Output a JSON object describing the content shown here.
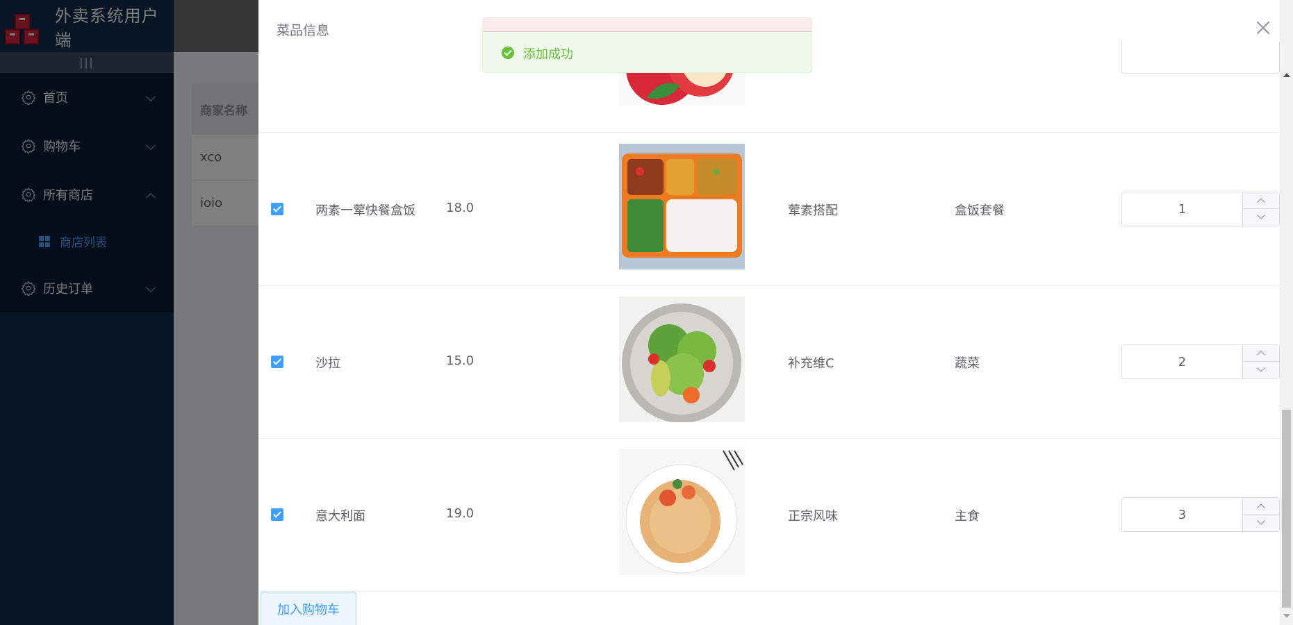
{
  "app": {
    "title": "外卖系统用户端",
    "collapse_glyph": "|||"
  },
  "sidebar": {
    "items": [
      {
        "label": "首页",
        "icon": "gear-icon",
        "expanded": false
      },
      {
        "label": "购物车",
        "icon": "gear-icon",
        "expanded": false
      },
      {
        "label": "所有商店",
        "icon": "gear-icon",
        "expanded": true
      },
      {
        "label": "历史订单",
        "icon": "gear-icon",
        "expanded": false
      }
    ],
    "sub_items": [
      {
        "label": "商店列表",
        "icon": "grid-icon",
        "active": true
      }
    ]
  },
  "background_table": {
    "header": "商家名称",
    "rows": [
      "xco",
      "ioio"
    ]
  },
  "drawer": {
    "title": "菜品信息",
    "rows": [
      {
        "name": "两素一荤快餐盒饭",
        "price": "18.0",
        "image": "bento-box-meal",
        "description": "荤素搭配",
        "category": "盒饭套餐",
        "quantity": "1",
        "checked": true
      },
      {
        "name": "沙拉",
        "price": "15.0",
        "image": "salad-plate",
        "description": "补充维C",
        "category": "蔬菜",
        "quantity": "2",
        "checked": true
      },
      {
        "name": "意大利面",
        "price": "19.0",
        "image": "spaghetti-plate",
        "description": "正宗风味",
        "category": "主食",
        "quantity": "3",
        "checked": true
      }
    ],
    "partial_top_image": "apple",
    "add_to_cart_label": "加入购物车"
  },
  "toast": {
    "message": "添加成功",
    "type": "success"
  },
  "colors": {
    "sidebar": "#0f2a4a",
    "menu": "#081e36",
    "accent": "#409eff",
    "success": "#67c23a"
  }
}
